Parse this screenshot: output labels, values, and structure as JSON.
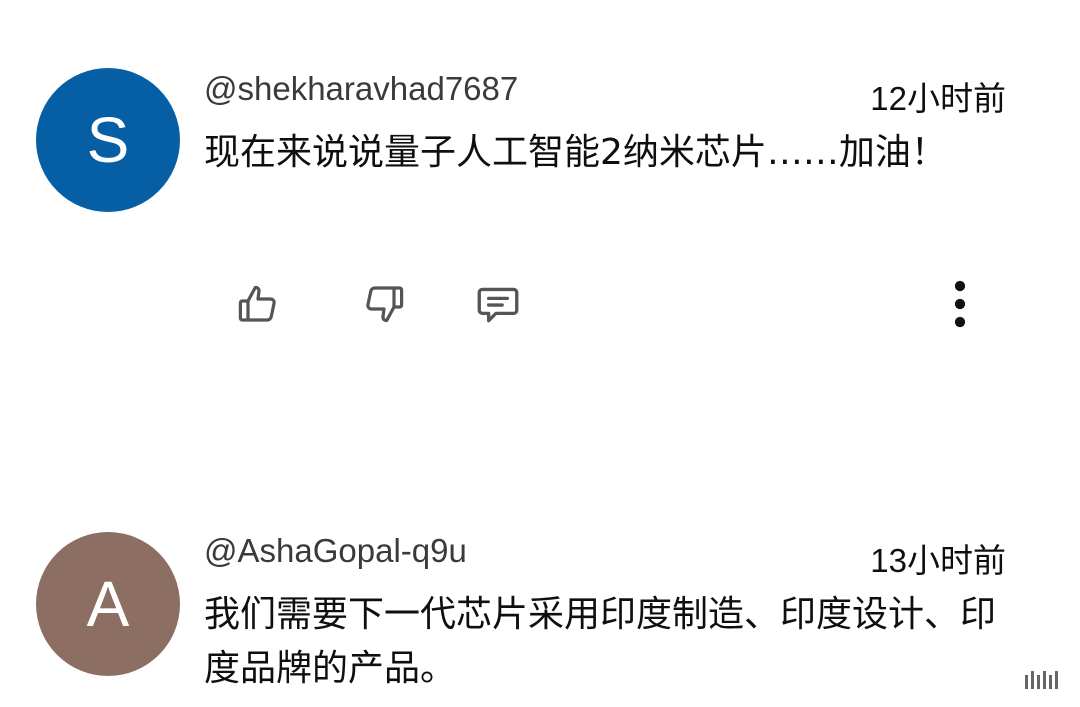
{
  "comments": [
    {
      "avatar_letter": "S",
      "avatar_color": "#065fa4",
      "author": "@shekharavhad7687",
      "time": "12小时前",
      "text": "现在来说说量子人工智能2纳米芯片……加油！"
    },
    {
      "avatar_letter": "A",
      "avatar_color": "#8d6e63",
      "author": "@AshaGopal-q9u",
      "time": "13小时前",
      "text": "我们需要下一代芯片采用印度制造、印度设计、印度品牌的产品。"
    }
  ],
  "actions": {
    "icons": [
      "thumbs-up-icon",
      "thumbs-down-icon",
      "reply-comment-icon",
      "more-vertical-icon"
    ]
  }
}
